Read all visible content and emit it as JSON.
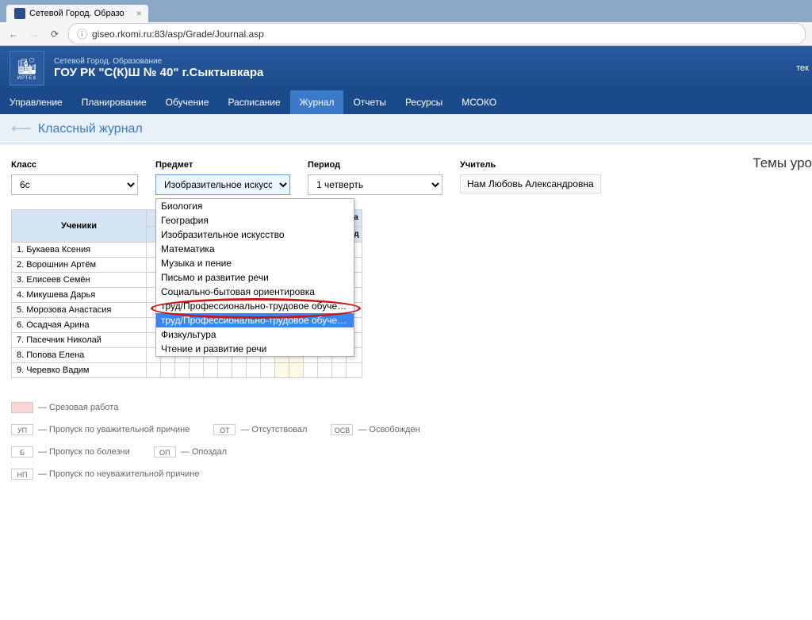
{
  "browser": {
    "tab_title": "Сетевой Город. Образо",
    "url": "giseo.rkomi.ru:83/asp/Grade/Journal.asp"
  },
  "header": {
    "small": "Сетевой Город. Образование",
    "big": "ГОУ РК \"С(К)Ш № 40\" г.Сыктывкара",
    "right": "тек",
    "logo_label": "ИРТЕХ"
  },
  "nav": [
    "Управление",
    "Планирование",
    "Обучение",
    "Расписание",
    "Журнал",
    "Отчеты",
    "Ресурсы",
    "МСОКО"
  ],
  "nav_active": 4,
  "page_title": "Классный журнал",
  "right_title": "Темы уро",
  "filters": {
    "class_label": "Класс",
    "class_value": "6с",
    "subject_label": "Предмет",
    "subject_value": "Изобразительное искусство",
    "period_label": "Период",
    "period_value": "1 четверть",
    "teacher_label": "Учитель",
    "teacher_value": "Нам Любовь Александровна"
  },
  "dropdown_options": [
    "Биология",
    "География",
    "Изобразительное искусство",
    "Математика",
    "Музыка и пение",
    "Письмо и развитие речи",
    "Социально-бытовая ориентировка",
    "труд/Профессионально-трудовое обучение/Ст.д.",
    "труд/Профессионально-трудовое обучение/Шв.д.",
    "Физкультура",
    "Чтение и развитие речи"
  ],
  "dropdown_highlight": 8,
  "table": {
    "students_header": "Ученики",
    "right_col1": "ка",
    "right_col2": "од",
    "students": [
      "1. Букаева Ксения",
      "2. Ворошнин Артём",
      "3. Елисеев Семён",
      "4. Микушева Дарья",
      "5. Морозова Анастасия",
      "6. Осадчая Арина",
      "7. Пасечник Николай",
      "8. Попова Елена",
      "9. Черевко Вадим"
    ]
  },
  "legend": {
    "srez": "— Срезовая работа",
    "up": "УП",
    "up_text": "— Пропуск по уважительной причине",
    "ot": "ОТ",
    "ot_text": "— Отсутствовал",
    "osv": "ОСВ",
    "osv_text": "— Освобожден",
    "b": "Б",
    "b_text": "— Пропуск по болезни",
    "op": "ОП",
    "op_text": "— Опоздал",
    "np": "НП",
    "np_text": "— Пропуск по неуважительной причине"
  }
}
